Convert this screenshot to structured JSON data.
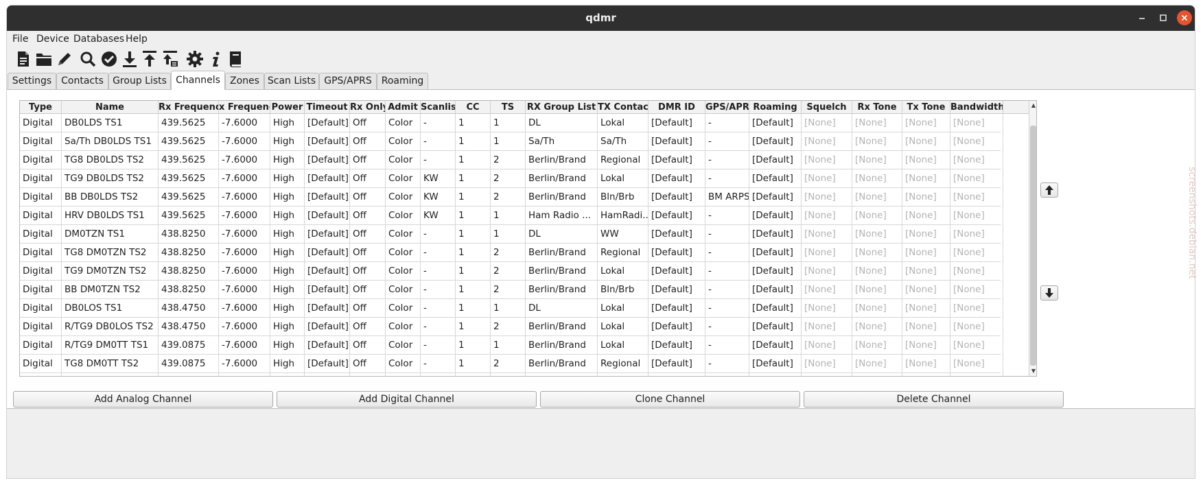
{
  "window": {
    "title": "qdmr"
  },
  "menubar": {
    "items": [
      "File",
      "Device",
      "Databases",
      "Help"
    ]
  },
  "toolbar": {
    "icons": [
      "new-file-icon",
      "open-folder-icon",
      "edit-pencil-icon",
      "search-icon",
      "verify-check-icon",
      "download-icon",
      "upload-icon",
      "upload-callsign-db-icon",
      "settings-gear-icon",
      "info-icon",
      "manual-book-icon"
    ]
  },
  "tabs": {
    "items": [
      "Settings",
      "Contacts",
      "Group Lists",
      "Channels",
      "Zones",
      "Scan Lists",
      "GPS/APRS",
      "Roaming"
    ],
    "active": "Channels"
  },
  "table": {
    "columns": [
      "Type",
      "Name",
      "Rx Frequency",
      "x Frequenc",
      "Power",
      "Timeout",
      "Rx Only",
      "Admit",
      "Scanlist",
      "CC",
      "TS",
      "RX Group List",
      "TX Contact",
      "DMR ID",
      "GPS/APRS",
      "Roaming",
      "Squelch",
      "Rx Tone",
      "Tx Tone",
      "Bandwidth"
    ],
    "rows": [
      [
        "Digital",
        "DB0LDS TS1",
        "439.5625",
        "-7.6000",
        "High",
        "[Default]",
        "Off",
        "Color",
        "-",
        "1",
        "1",
        "DL",
        "Lokal",
        "[Default]",
        "-",
        "[Default]",
        "[None]",
        "[None]",
        "[None]",
        "[None]"
      ],
      [
        "Digital",
        "Sa/Th DB0LDS TS1",
        "439.5625",
        "-7.6000",
        "High",
        "[Default]",
        "Off",
        "Color",
        "-",
        "1",
        "1",
        "Sa/Th",
        "Sa/Th",
        "[Default]",
        "-",
        "[Default]",
        "[None]",
        "[None]",
        "[None]",
        "[None]"
      ],
      [
        "Digital",
        "TG8 DB0LDS TS2",
        "439.5625",
        "-7.6000",
        "High",
        "[Default]",
        "Off",
        "Color",
        "-",
        "1",
        "2",
        "Berlin/Brand",
        "Regional",
        "[Default]",
        "-",
        "[Default]",
        "[None]",
        "[None]",
        "[None]",
        "[None]"
      ],
      [
        "Digital",
        "TG9 DB0LDS TS2",
        "439.5625",
        "-7.6000",
        "High",
        "[Default]",
        "Off",
        "Color",
        "KW",
        "1",
        "2",
        "Berlin/Brand",
        "Lokal",
        "[Default]",
        "-",
        "[Default]",
        "[None]",
        "[None]",
        "[None]",
        "[None]"
      ],
      [
        "Digital",
        "BB DB0LDS TS2",
        "439.5625",
        "-7.6000",
        "High",
        "[Default]",
        "Off",
        "Color",
        "KW",
        "1",
        "2",
        "Berlin/Brand",
        "Bln/Brb",
        "[Default]",
        "BM ARPS",
        "[Default]",
        "[None]",
        "[None]",
        "[None]",
        "[None]"
      ],
      [
        "Digital",
        "HRV DB0LDS TS1",
        "439.5625",
        "-7.6000",
        "High",
        "[Default]",
        "Off",
        "Color",
        "KW",
        "1",
        "1",
        "Ham Radio ...",
        "HamRadi...",
        "[Default]",
        "-",
        "[Default]",
        "[None]",
        "[None]",
        "[None]",
        "[None]"
      ],
      [
        "Digital",
        "DM0TZN TS1",
        "438.8250",
        "-7.6000",
        "High",
        "[Default]",
        "Off",
        "Color",
        "-",
        "1",
        "1",
        "DL",
        "WW",
        "[Default]",
        "-",
        "[Default]",
        "[None]",
        "[None]",
        "[None]",
        "[None]"
      ],
      [
        "Digital",
        "TG8 DM0TZN TS2",
        "438.8250",
        "-7.6000",
        "High",
        "[Default]",
        "Off",
        "Color",
        "-",
        "1",
        "2",
        "Berlin/Brand",
        "Regional",
        "[Default]",
        "-",
        "[Default]",
        "[None]",
        "[None]",
        "[None]",
        "[None]"
      ],
      [
        "Digital",
        "TG9 DM0TZN TS2",
        "438.8250",
        "-7.6000",
        "High",
        "[Default]",
        "Off",
        "Color",
        "-",
        "1",
        "2",
        "Berlin/Brand",
        "Lokal",
        "[Default]",
        "-",
        "[Default]",
        "[None]",
        "[None]",
        "[None]",
        "[None]"
      ],
      [
        "Digital",
        "BB DM0TZN TS2",
        "438.8250",
        "-7.6000",
        "High",
        "[Default]",
        "Off",
        "Color",
        "-",
        "1",
        "2",
        "Berlin/Brand",
        "Bln/Brb",
        "[Default]",
        "-",
        "[Default]",
        "[None]",
        "[None]",
        "[None]",
        "[None]"
      ],
      [
        "Digital",
        "DB0LOS TS1",
        "438.4750",
        "-7.6000",
        "High",
        "[Default]",
        "Off",
        "Color",
        "-",
        "1",
        "1",
        "DL",
        "Lokal",
        "[Default]",
        "-",
        "[Default]",
        "[None]",
        "[None]",
        "[None]",
        "[None]"
      ],
      [
        "Digital",
        "R/TG9 DB0LOS TS2",
        "438.4750",
        "-7.6000",
        "High",
        "[Default]",
        "Off",
        "Color",
        "-",
        "1",
        "2",
        "Berlin/Brand",
        "Lokal",
        "[Default]",
        "-",
        "[Default]",
        "[None]",
        "[None]",
        "[None]",
        "[None]"
      ],
      [
        "Digital",
        "R/TG9 DM0TT TS1",
        "439.0875",
        "-7.6000",
        "High",
        "[Default]",
        "Off",
        "Color",
        "-",
        "1",
        "1",
        "Berlin/Brand",
        "Lokal",
        "[Default]",
        "-",
        "[Default]",
        "[None]",
        "[None]",
        "[None]",
        "[None]"
      ],
      [
        "Digital",
        "TG8 DM0TT TS2",
        "439.0875",
        "-7.6000",
        "High",
        "[Default]",
        "Off",
        "Color",
        "-",
        "1",
        "2",
        "Berlin/Brand",
        "Regional",
        "[Default]",
        "-",
        "[Default]",
        "[None]",
        "[None]",
        "[None]",
        "[None]"
      ],
      [
        "",
        "",
        "",
        "",
        "",
        "",
        "",
        "",
        "",
        "",
        "",
        "",
        "",
        "",
        "",
        "",
        "",
        "",
        "",
        ""
      ]
    ]
  },
  "side_buttons": {
    "move_up_icon": "arrow-up-icon",
    "move_down_icon": "arrow-down-icon"
  },
  "actions": {
    "add_analog": "Add Analog Channel",
    "add_digital": "Add Digital Channel",
    "clone": "Clone Channel",
    "delete": "Delete Channel"
  },
  "watermark": "screenshots.debian.net",
  "colors": {
    "titlebar": "#2f2f2f",
    "close_button": "#e6532d",
    "muted_text": "#b3b3b3"
  }
}
